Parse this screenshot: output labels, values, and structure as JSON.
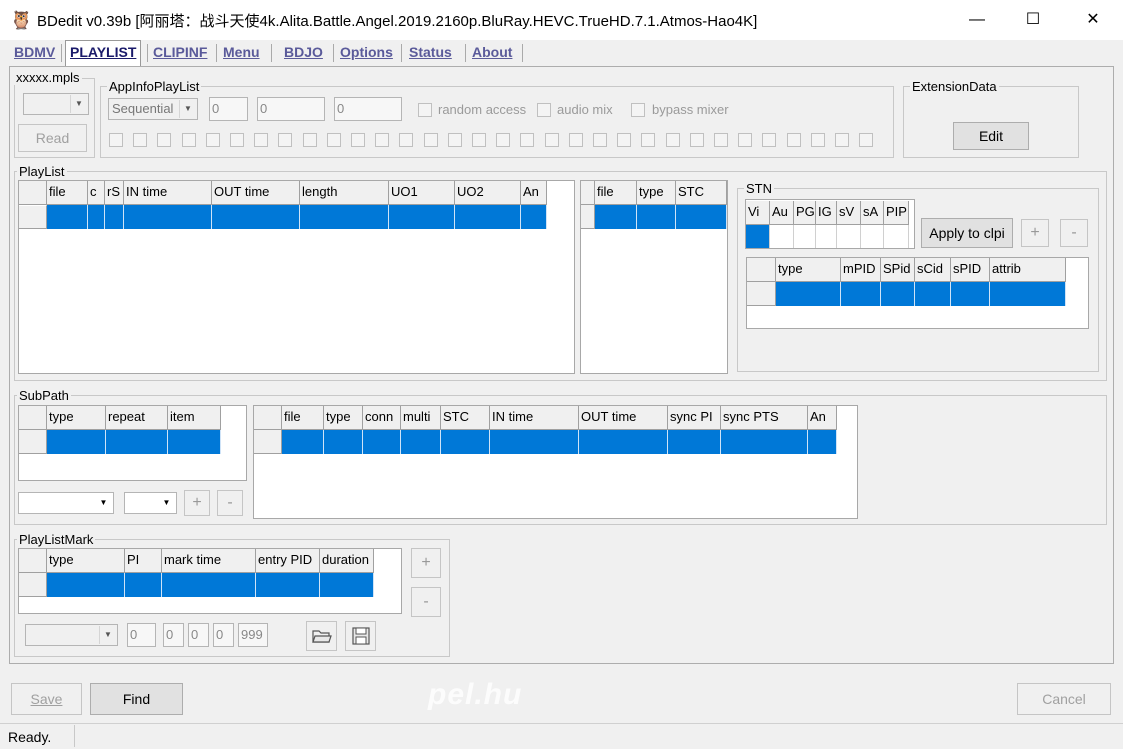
{
  "window": {
    "title": "BDedit v0.39b [阿丽塔：战斗天使4k.Alita.Battle.Angel.2019.2160p.BluRay.HEVC.TrueHD.7.1.Atmos-Hao4K]",
    "minimize": "—",
    "maximize": "☐",
    "close": "✕",
    "app_icon": "🦉"
  },
  "tabs": [
    "BDMV",
    "PLAYLIST",
    "CLIPINF",
    "Menu",
    "BDJO",
    "Options",
    "Status",
    "About"
  ],
  "active_tab": "PLAYLIST",
  "file_group": {
    "label": "xxxxx.mpls",
    "read_button": "Read"
  },
  "appinfo": {
    "label": "AppInfoPlayList",
    "playback_type": "Sequential",
    "field1": "0",
    "field2": "0",
    "field3": "0",
    "random_access": "random access",
    "audio_mix": "audio mix",
    "bypass_mixer": "bypass mixer"
  },
  "extension": {
    "label": "ExtensionData",
    "edit_button": "Edit"
  },
  "playlist": {
    "label": "PlayList",
    "columns": [
      "file",
      "c",
      "rS",
      "IN time",
      "OUT time",
      "length",
      "UO1",
      "UO2",
      "An"
    ],
    "clip_columns": [
      "file",
      "type",
      "STC"
    ]
  },
  "stn": {
    "label": "STN",
    "columns": [
      "Vi",
      "Au",
      "PG",
      "IG",
      "sV",
      "sA",
      "PIP"
    ],
    "apply_button": "Apply to clpi",
    "add_button": "+",
    "remove_button": "-",
    "stream_columns": [
      "type",
      "mPID",
      "SPid",
      "sCid",
      "sPID",
      "attrib"
    ]
  },
  "subpath": {
    "label": "SubPath",
    "columns": [
      "type",
      "repeat",
      "item"
    ],
    "item_columns": [
      "file",
      "type",
      "conn",
      "multi",
      "STC",
      "IN time",
      "OUT time",
      "sync PI",
      "sync PTS",
      "An"
    ],
    "add_button": "+",
    "remove_button": "-"
  },
  "mark": {
    "label": "PlayListMark",
    "columns": [
      "type",
      "PI",
      "mark time",
      "entry PID",
      "duration"
    ],
    "add_button": "+",
    "remove_button": "-",
    "f1": "0",
    "f2": "0",
    "f3": "0",
    "f4": "0",
    "f5": "999"
  },
  "footer": {
    "save_button": "Save",
    "find_button": "Find",
    "cancel_button": "Cancel",
    "watermark": "pel.hu",
    "status": "Ready."
  },
  "colors": {
    "selection": "#0078d7",
    "tab_text": "#5a5a9a",
    "disabled_text": "#a0a0a0"
  }
}
